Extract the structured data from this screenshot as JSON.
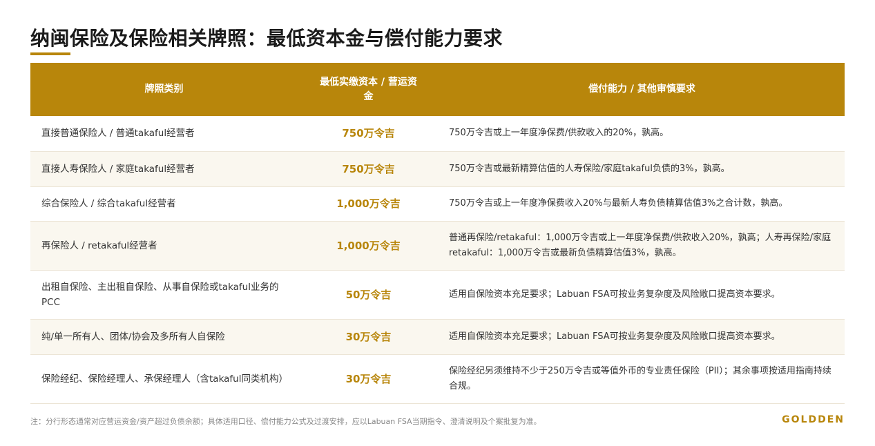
{
  "title": "纳闽保险及保险相关牌照：最低资本金与偿付能力要求",
  "colors": {
    "accent": "#b8860b",
    "row_alt": "#faf7ef"
  },
  "table": {
    "headers": [
      "牌照类别",
      "最低实缴资本 / 营运资金",
      "偿付能力 / 其他审慎要求"
    ],
    "rows": [
      {
        "category": "直接普通保险人 / 普通takaful经营者",
        "capital": "750万令吉",
        "requirement": "750万令吉或上一年度净保费/供款收入的20%，孰高。"
      },
      {
        "category": "直接人寿保险人 / 家庭takaful经营者",
        "capital": "750万令吉",
        "requirement": "750万令吉或最新精算估值的人寿保险/家庭takaful负债的3%，孰高。"
      },
      {
        "category": "综合保险人 / 综合takaful经营者",
        "capital": "1,000万令吉",
        "requirement": "750万令吉或上一年度净保费收入20%与最新人寿负债精算估值3%之合计数，孰高。"
      },
      {
        "category": "再保险人 / retakaful经营者",
        "capital": "1,000万令吉",
        "requirement": "普通再保险/retakaful：1,000万令吉或上一年度净保费/供款收入20%，孰高；人寿再保险/家庭retakaful：1,000万令吉或最新负债精算估值3%，孰高。"
      },
      {
        "category": "出租自保险、主出租自保险、从事自保险或takaful业务的PCC",
        "capital": "50万令吉",
        "requirement": "适用自保险资本充足要求；Labuan FSA可按业务复杂度及风险敞口提高资本要求。"
      },
      {
        "category": "纯/单一所有人、团体/协会及多所有人自保险",
        "capital": "30万令吉",
        "requirement": "适用自保险资本充足要求；Labuan FSA可按业务复杂度及风险敞口提高资本要求。"
      },
      {
        "category": "保险经纪、保险经理人、承保经理人（含takaful同类机构）",
        "capital": "30万令吉",
        "requirement": "保险经纪另须维持不少于250万令吉或等值外币的专业责任保险（PII）；其余事项按适用指南持续合规。"
      }
    ]
  },
  "footnote": "注：分行形态通常对应营运资金/资产超过负债余额；具体适用口径、偿付能力公式及过渡安排，应以Labuan FSA当期指令、澄清说明及个案批复为准。",
  "brand": "GOLDDEN"
}
